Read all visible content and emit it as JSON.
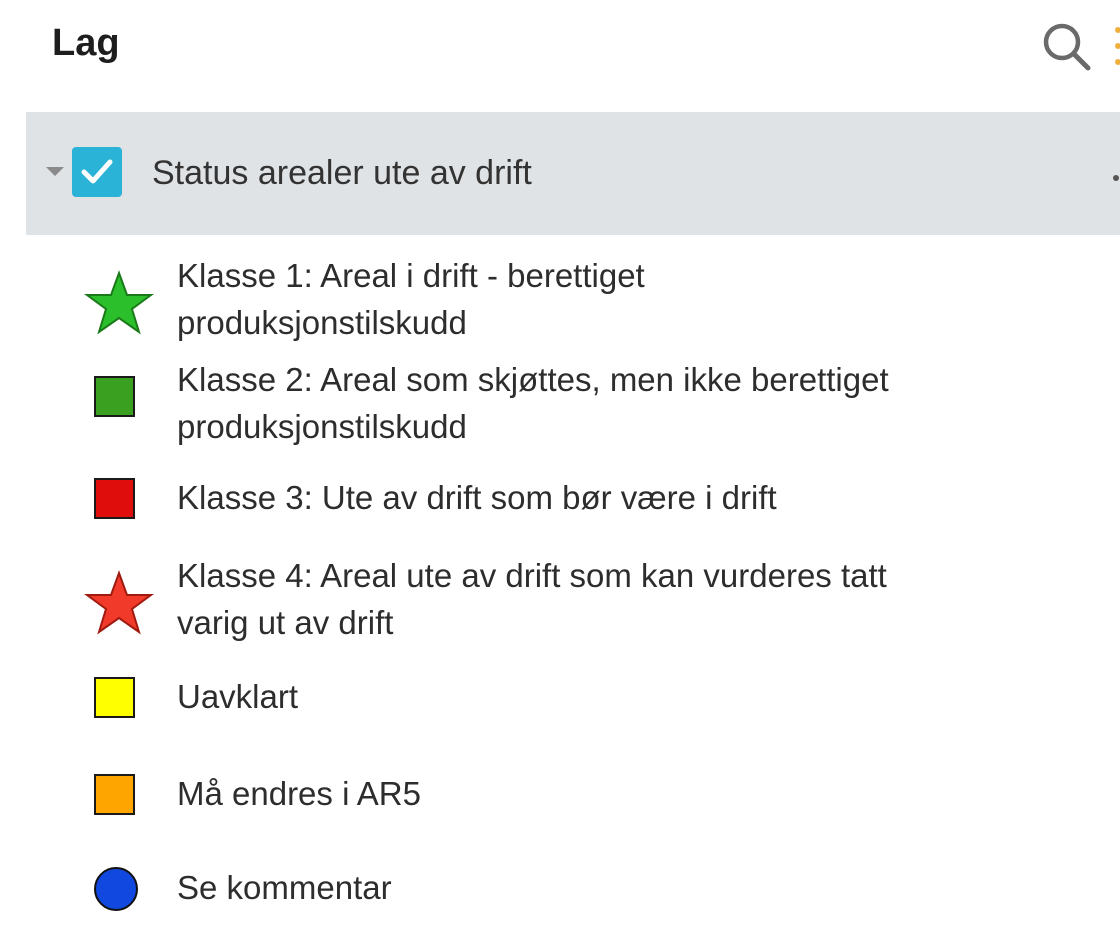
{
  "header": {
    "title": "Lag"
  },
  "group": {
    "label": "Status arealer ute av drift",
    "checked": true,
    "expanded": true
  },
  "legend": {
    "items": [
      {
        "line1": "Klasse 1: Areal i drift - berettiget",
        "line2": "produksjonstilskudd",
        "symbol": "star-icon",
        "color": "#2bc02b"
      },
      {
        "line1": "Klasse 2: Areal som skjøttes, men ikke berettiget",
        "line2": "produksjonstilskudd",
        "symbol": "square-icon",
        "color": "#3aa120"
      },
      {
        "line1": "Klasse 3: Ute av drift som bør være i drift",
        "line2": "",
        "symbol": "square-icon",
        "color": "#e00d0d"
      },
      {
        "line1": "Klasse 4: Areal ute av drift som kan vurderes tatt",
        "line2": "varig ut av drift",
        "symbol": "star-icon",
        "color": "#f23a2a"
      },
      {
        "line1": "Uavklart",
        "line2": "",
        "symbol": "square-icon",
        "color": "#ffff00"
      },
      {
        "line1": "Må endres i AR5",
        "line2": "",
        "symbol": "square-icon",
        "color": "#ffa500"
      },
      {
        "line1": "Se kommentar",
        "line2": "",
        "symbol": "circle-icon",
        "color": "#1149e0"
      }
    ]
  },
  "colors": {
    "accent": "#2ab3d6",
    "group_bg": "#dfe3e6"
  }
}
